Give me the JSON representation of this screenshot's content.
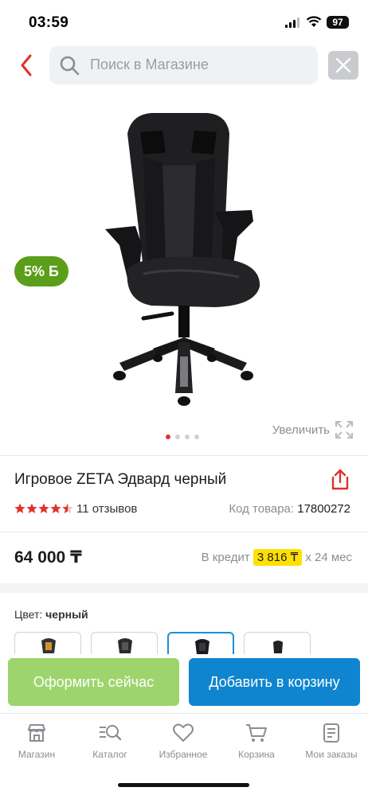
{
  "status_bar": {
    "time": "03:59",
    "battery": "97"
  },
  "search": {
    "placeholder": "Поиск в Магазине"
  },
  "gallery": {
    "discount_value": "5%",
    "discount_suffix": "Б",
    "zoom_label": "Увеличить",
    "slide_count": 4,
    "active_slide": 1
  },
  "product": {
    "title": "Игровое ZETA Эдвард черный",
    "rating_stars": 4.5,
    "reviews": "11 отзывов",
    "sku_label": "Код товара:",
    "sku": "17800272",
    "price": "64 000 ₸",
    "credit_prefix": "В кредит",
    "credit_amount": "3 816 ₸",
    "credit_suffix": "х 24 мес"
  },
  "colors": {
    "label": "Цвет:",
    "selected": "черный",
    "selected_index": 2
  },
  "actions": {
    "buy_now": "Оформить сейчас",
    "add_to_cart": "Добавить в корзину"
  },
  "tabbar": {
    "items": [
      {
        "label": "Магазин",
        "icon": "shop-icon"
      },
      {
        "label": "Каталог",
        "icon": "catalog-search-icon"
      },
      {
        "label": "Избранное",
        "icon": "heart-icon"
      },
      {
        "label": "Корзина",
        "icon": "cart-icon"
      },
      {
        "label": "Мои заказы",
        "icon": "orders-icon"
      }
    ]
  },
  "theme": {
    "accent_red": "#e0312a",
    "discount_green": "#5b9e1a",
    "buy_now_green": "#9dd56c",
    "cart_blue": "#0f85cf",
    "credit_highlight": "#ffe000"
  }
}
